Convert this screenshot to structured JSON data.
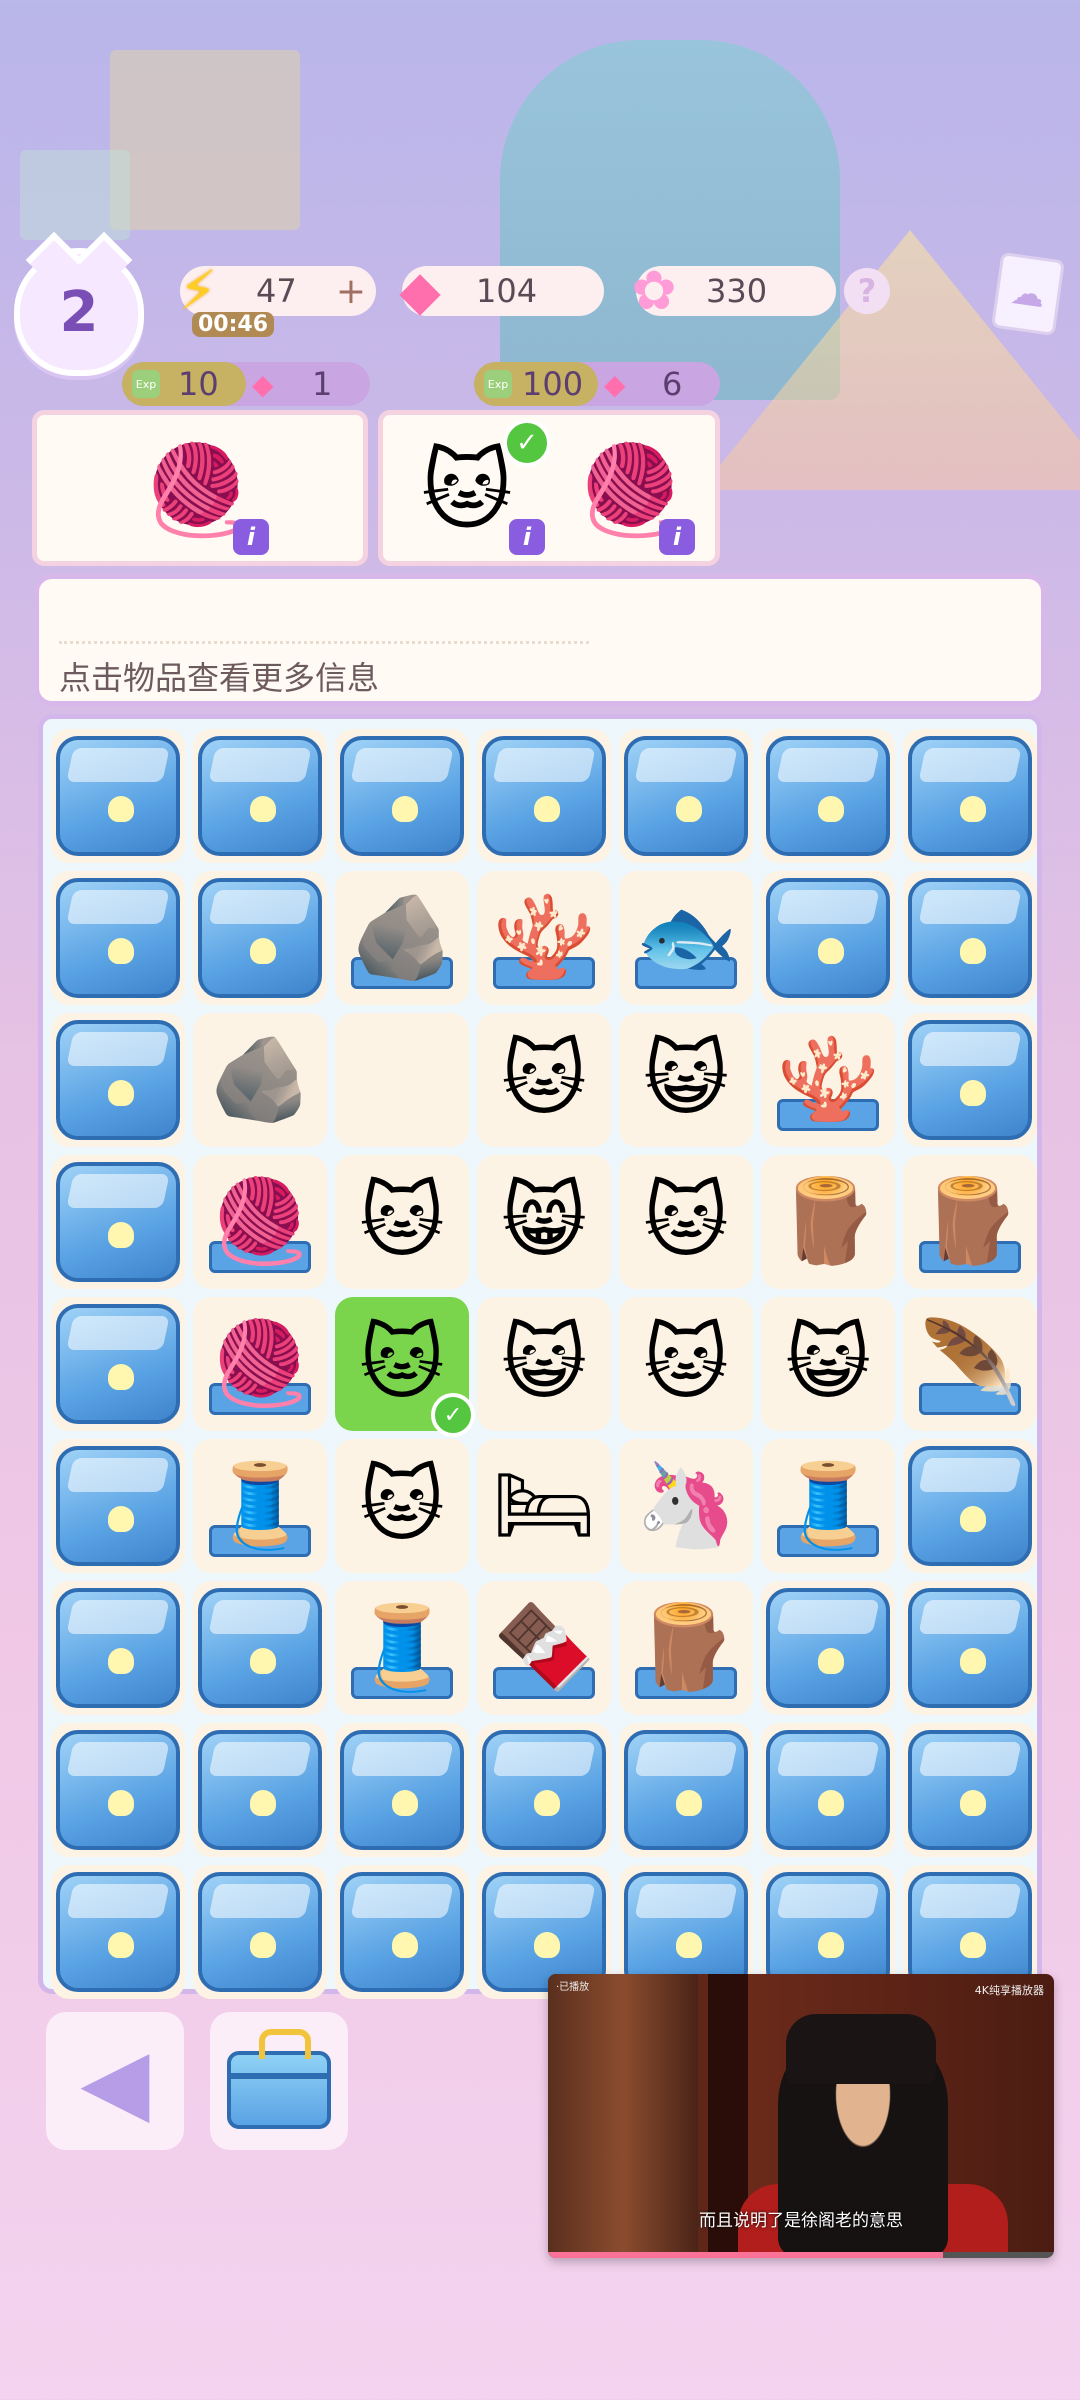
{
  "header": {
    "level": "2",
    "energy": {
      "value": "47",
      "plus": "+",
      "timer": "00:46",
      "icon": "lightning-icon"
    },
    "gems": {
      "value": "104",
      "icon": "pink-gem-icon"
    },
    "stars": {
      "value": "330",
      "icon": "rainbow-star-icon"
    },
    "help_label": "?",
    "album_icon": "cat-card-icon"
  },
  "orders": [
    {
      "exp": "10",
      "gems": "1",
      "items": [
        "yarn-ball"
      ],
      "completed": [
        false
      ]
    },
    {
      "exp": "100",
      "gems": "6",
      "items": [
        "cat-with-frog-hat",
        "yarn-ball-pink"
      ],
      "completed": [
        true,
        false
      ]
    }
  ],
  "exp_tag": "Exp",
  "info": {
    "hint": "点击物品查看更多信息"
  },
  "board": {
    "rows": [
      [
        "box",
        "box",
        "box",
        "box",
        "box",
        "box",
        "box"
      ],
      [
        "box",
        "box",
        "stone-tray",
        "coral-tray",
        "taiyaki-tray",
        "box",
        "box"
      ],
      [
        "box",
        "stone",
        "empty",
        "calico-cat-bed",
        "bow-cat",
        "coral-tray",
        "box"
      ],
      [
        "box",
        "yarn-tray",
        "siamese-cat",
        "bow-kitten",
        "reading-cat",
        "wood-slice",
        "branch-tray"
      ],
      [
        "box",
        "yarn-tray",
        "frog-hat-cat",
        "bib-cat",
        "rose-cat",
        "desk-cat",
        "feather-tray"
      ],
      [
        "box",
        "spool-tray",
        "crown-tabby",
        "cat-bed",
        "unicorn-cat",
        "spool-tray",
        "box"
      ],
      [
        "box",
        "box",
        "spool-tray",
        "chocolate-tray",
        "log-tray",
        "box",
        "box"
      ],
      [
        "box",
        "box",
        "box",
        "box",
        "box",
        "box",
        "box"
      ],
      [
        "box",
        "box",
        "box",
        "box",
        "box",
        "box",
        "box"
      ]
    ],
    "selected": {
      "row": 4,
      "col": 2
    }
  },
  "buttons": {
    "back_icon": "back-arrow-icon",
    "bag_icon": "toolbox-icon"
  },
  "pip_video": {
    "subtitle": "而且说明了是徐阁老的意思",
    "top_label": "4K纯享播放器",
    "top_left": "·已播放",
    "progress": 0.78
  }
}
